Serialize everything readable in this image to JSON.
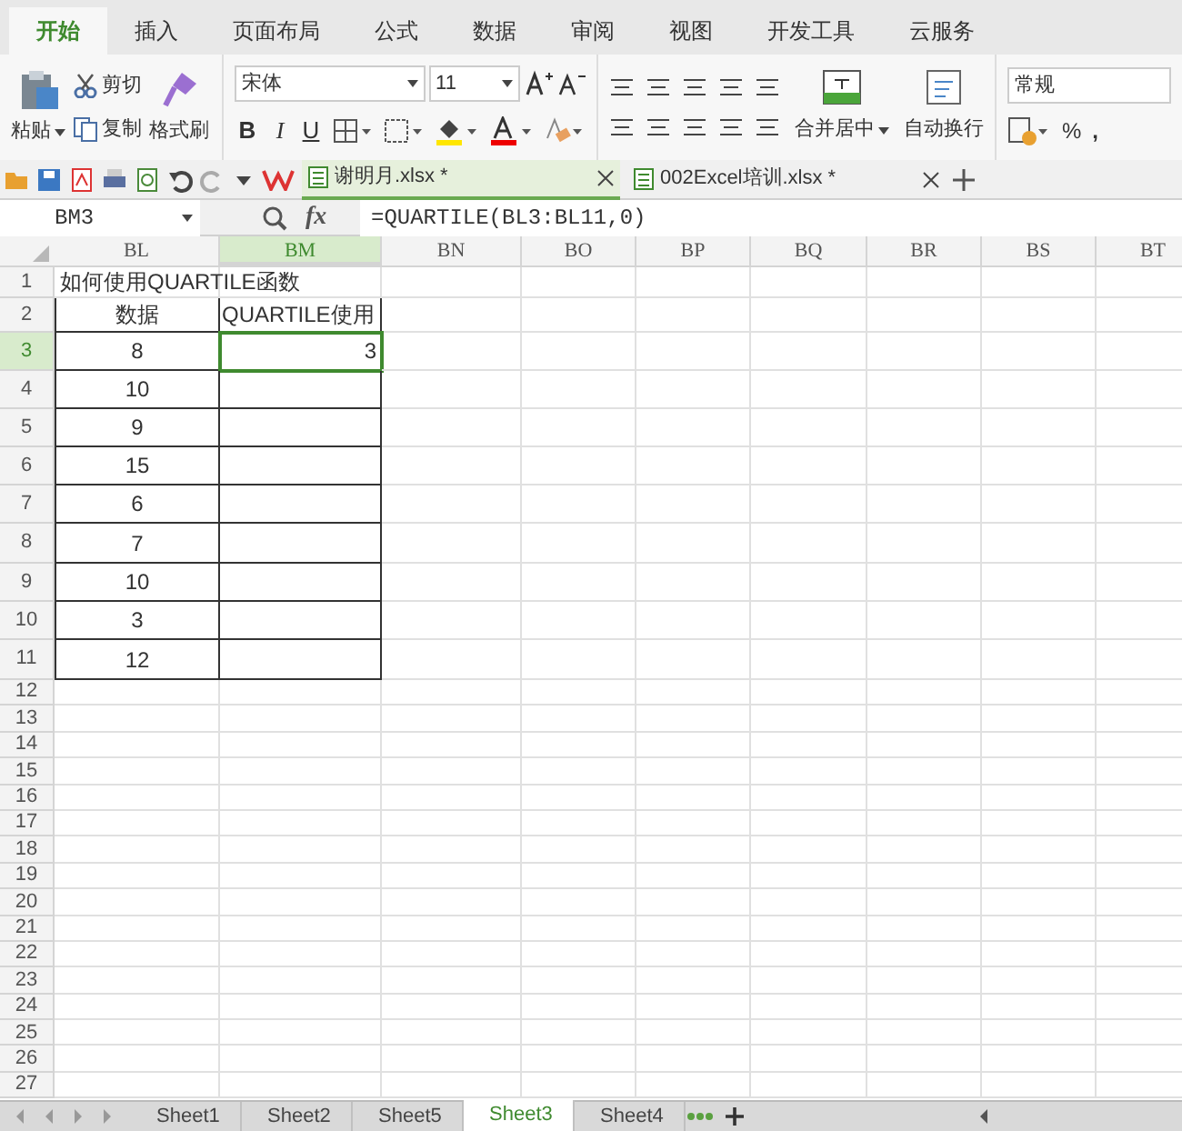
{
  "ribbon_tabs": [
    {
      "label": "开始",
      "selected": true
    },
    {
      "label": "插入",
      "selected": false
    },
    {
      "label": "页面布局",
      "selected": false
    },
    {
      "label": "公式",
      "selected": false
    },
    {
      "label": "数据",
      "selected": false
    },
    {
      "label": "审阅",
      "selected": false
    },
    {
      "label": "视图",
      "selected": false
    },
    {
      "label": "开发工具",
      "selected": false
    },
    {
      "label": "云服务",
      "selected": false
    }
  ],
  "clipboard": {
    "paste": "粘贴",
    "cut": "剪切",
    "copy": "复制",
    "format_painter": "格式刷"
  },
  "font": {
    "name": "宋体",
    "size": "11",
    "bold": "B",
    "italic": "I",
    "underline": "U"
  },
  "alignment": {
    "merge": "合并居中",
    "wrap": "自动换行"
  },
  "number": {
    "format": "常规",
    "percent": "%",
    "comma": ","
  },
  "documents": [
    {
      "label": "谢明月.xlsx *",
      "selected": true
    },
    {
      "label": "002Excel培训.xlsx *",
      "selected": false
    }
  ],
  "formula_bar": {
    "name_box": "BM3",
    "fx": "fx",
    "formula": "=QUARTILE(BL3:BL11,0)"
  },
  "columns": [
    {
      "label": "BL",
      "selected": false
    },
    {
      "label": "BM",
      "selected": true
    },
    {
      "label": "BN",
      "selected": false
    },
    {
      "label": "BO",
      "selected": false
    },
    {
      "label": "BP",
      "selected": false
    },
    {
      "label": "BQ",
      "selected": false
    },
    {
      "label": "BR",
      "selected": false
    },
    {
      "label": "BS",
      "selected": false
    },
    {
      "label": "BT",
      "selected": false
    }
  ],
  "rows": [
    {
      "number": "1",
      "selected": false,
      "bordered": false,
      "cells": [
        {
          "text": "如何使用QUARTILE函数",
          "selected": false
        },
        {
          "selected": false
        }
      ]
    },
    {
      "number": "2",
      "selected": false,
      "bordered": true,
      "cells": [
        {
          "text": "数据",
          "selected": false
        },
        {
          "text": "QUARTILE使用",
          "selected": false
        }
      ]
    },
    {
      "number": "3",
      "selected": true,
      "bordered": true,
      "cells": [
        {
          "text": "8",
          "selected": false
        },
        {
          "text": "3",
          "selected": true
        }
      ]
    },
    {
      "number": "4",
      "selected": false,
      "bordered": true,
      "cells": [
        {
          "text": "10",
          "selected": false
        },
        {
          "selected": false
        }
      ]
    },
    {
      "number": "5",
      "selected": false,
      "bordered": true,
      "cells": [
        {
          "text": "9",
          "selected": false
        },
        {
          "selected": false
        }
      ]
    },
    {
      "number": "6",
      "selected": false,
      "bordered": true,
      "cells": [
        {
          "text": "15",
          "selected": false
        },
        {
          "selected": false
        }
      ]
    },
    {
      "number": "7",
      "selected": false,
      "bordered": true,
      "cells": [
        {
          "text": "6",
          "selected": false
        },
        {
          "selected": false
        }
      ]
    },
    {
      "number": "8",
      "selected": false,
      "bordered": true,
      "cells": [
        {
          "text": "7",
          "selected": false
        },
        {
          "selected": false
        }
      ]
    },
    {
      "number": "9",
      "selected": false,
      "bordered": true,
      "cells": [
        {
          "text": "10",
          "selected": false
        },
        {
          "selected": false
        }
      ]
    },
    {
      "number": "10",
      "selected": false,
      "bordered": true,
      "cells": [
        {
          "text": "3",
          "selected": false
        },
        {
          "selected": false
        }
      ]
    },
    {
      "number": "11",
      "selected": false,
      "bordered": true,
      "cells": [
        {
          "text": "12",
          "selected": false
        },
        {
          "selected": false
        }
      ]
    },
    {
      "number": "12",
      "selected": false,
      "bordered": false,
      "cells": []
    },
    {
      "number": "13",
      "selected": false,
      "bordered": false,
      "cells": []
    },
    {
      "number": "14",
      "selected": false,
      "bordered": false,
      "cells": []
    },
    {
      "number": "15",
      "selected": false,
      "bordered": false,
      "cells": []
    },
    {
      "number": "16",
      "selected": false,
      "bordered": false,
      "cells": []
    },
    {
      "number": "17",
      "selected": false,
      "bordered": false,
      "cells": []
    },
    {
      "number": "18",
      "selected": false,
      "bordered": false,
      "cells": []
    },
    {
      "number": "19",
      "selected": false,
      "bordered": false,
      "cells": []
    },
    {
      "number": "20",
      "selected": false,
      "bordered": false,
      "cells": []
    },
    {
      "number": "21",
      "selected": false,
      "bordered": false,
      "cells": []
    },
    {
      "number": "22",
      "selected": false,
      "bordered": false,
      "cells": []
    },
    {
      "number": "23",
      "selected": false,
      "bordered": false,
      "cells": []
    },
    {
      "number": "24",
      "selected": false,
      "bordered": false,
      "cells": []
    },
    {
      "number": "25",
      "selected": false,
      "bordered": false,
      "cells": []
    },
    {
      "number": "26",
      "selected": false,
      "bordered": false,
      "cells": []
    },
    {
      "number": "27",
      "selected": false,
      "bordered": false,
      "cells": []
    }
  ],
  "sheet_tabs": [
    {
      "label": "Sheet1",
      "selected": false
    },
    {
      "label": "Sheet2",
      "selected": false
    },
    {
      "label": "Sheet5",
      "selected": false
    },
    {
      "label": "Sheet3",
      "selected": true
    },
    {
      "label": "Sheet4",
      "selected": false
    }
  ]
}
